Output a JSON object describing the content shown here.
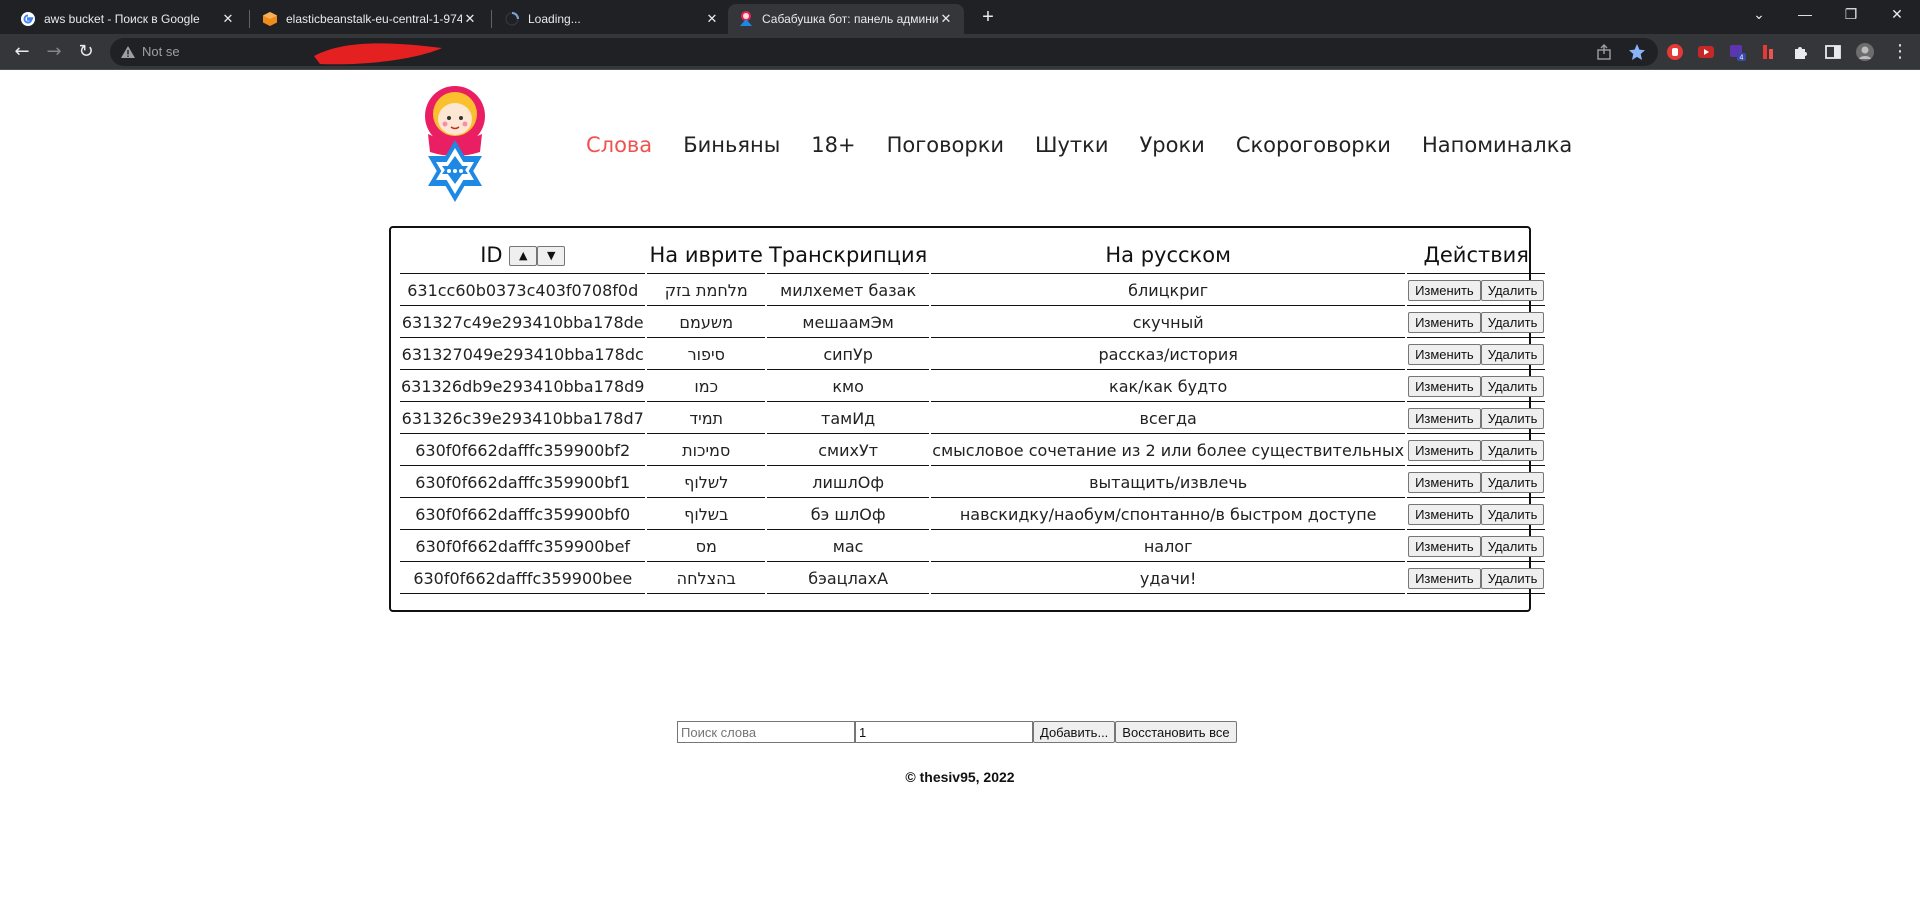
{
  "browser": {
    "tabs": [
      {
        "title": "aws bucket - Поиск в Google",
        "icon": "google-icon"
      },
      {
        "title": "elasticbeanstalk-eu-central-1-974",
        "icon": "aws-cube-icon"
      },
      {
        "title": "Loading...",
        "icon": "loading-spinner-icon"
      },
      {
        "title": "Сабабушка бот: панель админи",
        "icon": "matryoshka-icon"
      }
    ],
    "address": {
      "security_text": "Not se"
    }
  },
  "nav": {
    "items": [
      "Слова",
      "Биньяны",
      "18+",
      "Поговорки",
      "Шутки",
      "Уроки",
      "Скороговорки",
      "Напоминалка"
    ],
    "active": "Слова",
    "active_color": "#ef5350"
  },
  "table": {
    "headers": {
      "id": "ID",
      "hebrew": "На иврите",
      "transcription": "Транскрипция",
      "russian": "На русском",
      "actions": "Действия"
    },
    "sort_up": "▲",
    "sort_down": "▼",
    "edit_label": "Изменить",
    "delete_label": "Удалить",
    "rows": [
      {
        "id": "631cc60b0373c403f0708f0d",
        "hebrew": "מלחמת בזק",
        "transcription": "милхемет базак",
        "russian": "блицкриг"
      },
      {
        "id": "631327c49e293410bba178de",
        "hebrew": "משעמם",
        "transcription": "мешаамЭм",
        "russian": "скучный"
      },
      {
        "id": "631327049e293410bba178dc",
        "hebrew": "סיפור",
        "transcription": "сипУр",
        "russian": "рассказ/история"
      },
      {
        "id": "631326db9e293410bba178d9",
        "hebrew": "כמו",
        "transcription": "кмо",
        "russian": "как/как будто"
      },
      {
        "id": "631326c39e293410bba178d7",
        "hebrew": "תמיד",
        "transcription": "тамИд",
        "russian": "всегда"
      },
      {
        "id": "630f0f662dafffc359900bf2",
        "hebrew": "סמיכות",
        "transcription": "смихУт",
        "russian": "смысловое сочетание из 2 или более существительных"
      },
      {
        "id": "630f0f662dafffc359900bf1",
        "hebrew": "לשלוף",
        "transcription": "лишлОф",
        "russian": "вытащить/извлечь"
      },
      {
        "id": "630f0f662dafffc359900bf0",
        "hebrew": "בשלוף",
        "transcription": "бэ шлОф",
        "russian": "навскидку/наобум/спонтанно/в быстром доступе"
      },
      {
        "id": "630f0f662dafffc359900bef",
        "hebrew": "מס",
        "transcription": "мас",
        "russian": "налог"
      },
      {
        "id": "630f0f662dafffc359900bee",
        "hebrew": "בהצלחה",
        "transcription": "бэацлахА",
        "russian": "удачи!"
      }
    ]
  },
  "controls": {
    "search_placeholder": "Поиск слова",
    "page_value": "1",
    "add_label": "Добавить...",
    "restore_label": "Восстановить все"
  },
  "footer": {
    "text": "© thesiv95, 2022"
  }
}
